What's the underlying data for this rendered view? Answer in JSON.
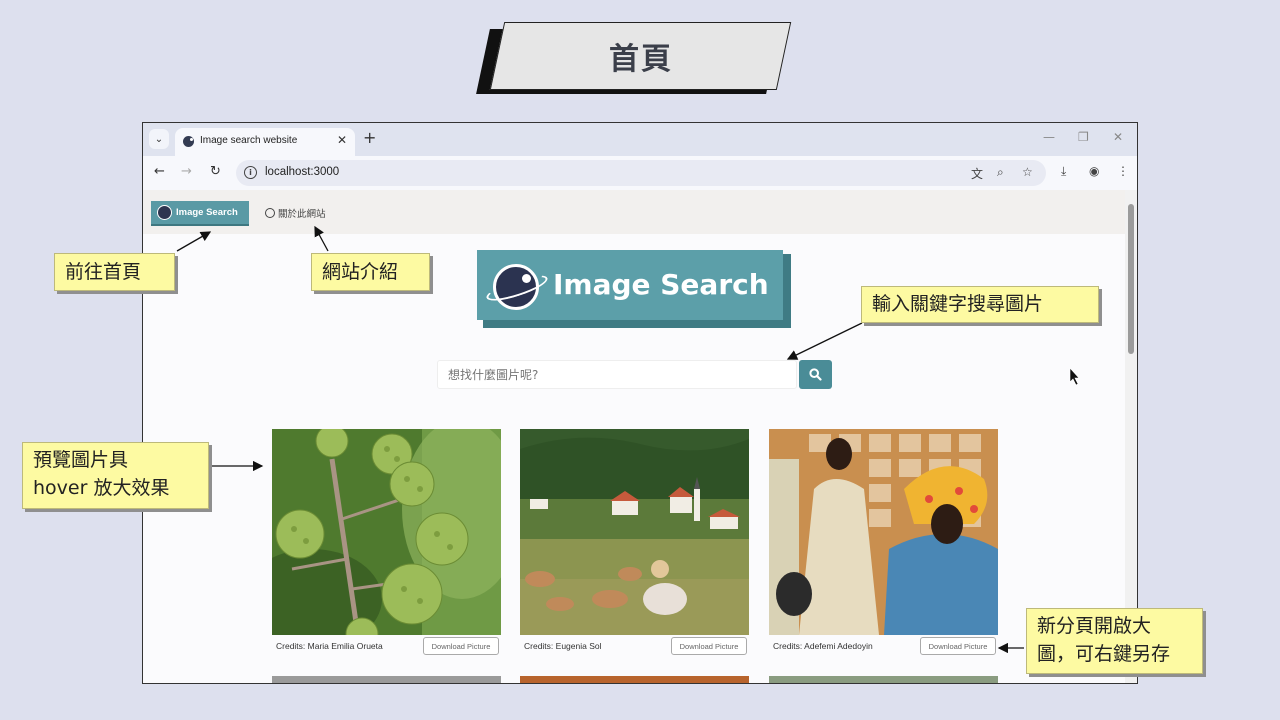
{
  "slide": {
    "title": "首頁"
  },
  "browser": {
    "tab_title": "Image search website",
    "url": "localhost:3000"
  },
  "site": {
    "nav_logo_text": "Image Search",
    "nav_about": "關於此網站",
    "hero_title": "Image Search",
    "search_placeholder": "想找什麼圖片呢?",
    "cards": [
      {
        "credit": "Credits: Maria Emilia Orueta",
        "download": "Download Picture",
        "image": "blackberries-photo"
      },
      {
        "credit": "Credits: Eugenia Sol",
        "download": "Download Picture",
        "image": "village-deer-photo"
      },
      {
        "credit": "Credits: Adefemi Adedoyin",
        "download": "Download Picture",
        "image": "fashion-portrait-photo"
      }
    ]
  },
  "callouts": {
    "home": "前往首頁",
    "about": "網站介紹",
    "search": "輸入關鍵字搜尋圖片",
    "hover_1": "預覽圖片具",
    "hover_2": "hover 放大效果",
    "download_1": "新分頁開啟大",
    "download_2": "圖，可右鍵另存"
  },
  "colors": {
    "accent": "#4a8c97",
    "callout_bg": "#fdfaa2",
    "slide_bg": "#dde0ee"
  }
}
